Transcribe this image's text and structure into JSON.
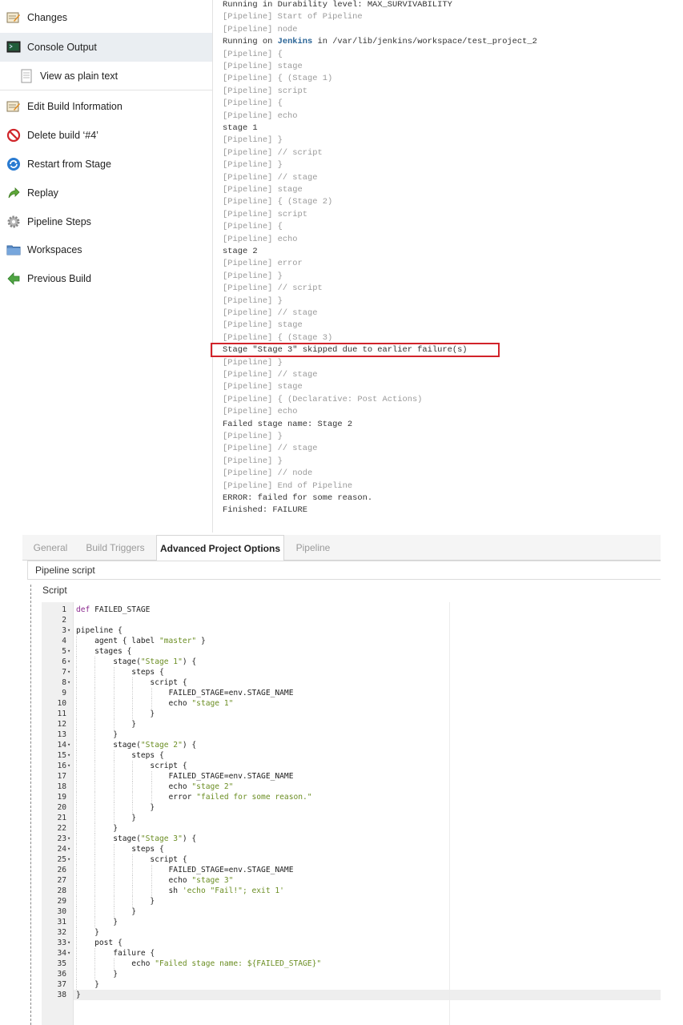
{
  "sidebar": {
    "items": [
      {
        "label": "Changes",
        "icon": "notepad-icon"
      },
      {
        "label": "Console Output",
        "icon": "terminal-icon"
      },
      {
        "label": "View as plain text",
        "icon": "document-icon"
      },
      {
        "label": "Edit Build Information",
        "icon": "notepad-icon"
      },
      {
        "label": "Delete build ‘#4’",
        "icon": "no-entry-icon"
      },
      {
        "label": "Restart from Stage",
        "icon": "refresh-icon"
      },
      {
        "label": "Replay",
        "icon": "replay-arrow-icon"
      },
      {
        "label": "Pipeline Steps",
        "icon": "gear-icon"
      },
      {
        "label": "Workspaces",
        "icon": "folder-icon"
      },
      {
        "label": "Previous Build",
        "icon": "arrow-left-icon"
      }
    ]
  },
  "console": {
    "lines": [
      "Running in Durability level: MAX_SURVIVABILITY",
      "[Pipeline] Start of Pipeline",
      "[Pipeline] node",
      "Running on ",
      "[Pipeline] {",
      "[Pipeline] stage",
      "[Pipeline] { (Stage 1)",
      "[Pipeline] script",
      "[Pipeline] {",
      "[Pipeline] echo",
      "stage 1",
      "[Pipeline] }",
      "[Pipeline] // script",
      "[Pipeline] }",
      "[Pipeline] // stage",
      "[Pipeline] stage",
      "[Pipeline] { (Stage 2)",
      "[Pipeline] script",
      "[Pipeline] {",
      "[Pipeline] echo",
      "stage 2",
      "[Pipeline] error",
      "[Pipeline] }",
      "[Pipeline] // script",
      "[Pipeline] }",
      "[Pipeline] // stage",
      "[Pipeline] stage",
      "[Pipeline] { (Stage 3)",
      "Stage \"Stage 3\" skipped due to earlier failure(s)",
      "[Pipeline] }",
      "[Pipeline] // stage",
      "[Pipeline] stage",
      "[Pipeline] { (Declarative: Post Actions)",
      "[Pipeline] echo",
      "Failed stage name: Stage 2",
      "[Pipeline] }",
      "[Pipeline] // stage",
      "[Pipeline] }",
      "[Pipeline] // node",
      "[Pipeline] End of Pipeline",
      "ERROR: failed for some reason.",
      "Finished: FAILURE"
    ],
    "running_on_link": "Jenkins",
    "running_on_suffix": " in /var/lib/jenkins/workspace/test_project_2"
  },
  "config": {
    "tabs": [
      "General",
      "Build Triggers",
      "Advanced Project Options",
      "Pipeline"
    ],
    "active_tab": "Advanced Project Options",
    "section_header": "Pipeline script",
    "script_label": "Script",
    "active_line": 38,
    "code_lines": [
      "def FAILED_STAGE",
      "",
      "pipeline {",
      "    agent { label \"master\" }",
      "    stages {",
      "        stage(\"Stage 1\") {",
      "            steps {",
      "                script {",
      "                    FAILED_STAGE=env.STAGE_NAME",
      "                    echo \"stage 1\"",
      "                }",
      "            }",
      "        }",
      "        stage(\"Stage 2\") {",
      "            steps {",
      "                script {",
      "                    FAILED_STAGE=env.STAGE_NAME",
      "                    echo \"stage 2\"",
      "                    error \"failed for some reason.\"",
      "                }",
      "            }",
      "        }",
      "        stage(\"Stage 3\") {",
      "            steps {",
      "                script {",
      "                    FAILED_STAGE=env.STAGE_NAME",
      "                    echo \"stage 3\"",
      "                    sh 'echo \"Fail!\"; exit 1'",
      "                }",
      "            }",
      "        }",
      "    }",
      "    post {",
      "        failure {",
      "            echo \"Failed stage name: ${FAILED_STAGE}\"",
      "        }",
      "    }",
      "}"
    ],
    "fold_lines": [
      3,
      5,
      6,
      7,
      8,
      14,
      15,
      16,
      23,
      24,
      25,
      33,
      34
    ]
  },
  "colors": {
    "highlight_border": "#d2232a",
    "link": "#2a6496",
    "string": "#6b8e23",
    "keyword": "#8b2a8f"
  }
}
